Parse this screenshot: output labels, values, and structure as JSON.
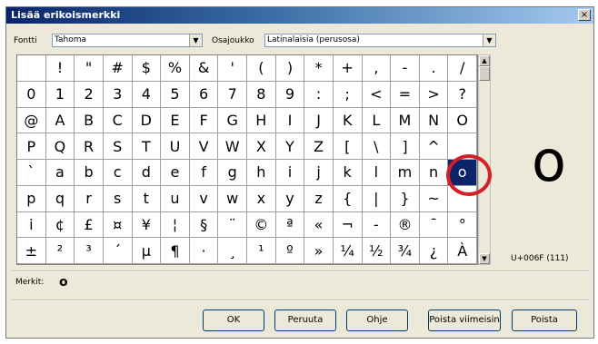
{
  "dialog": {
    "title": "Lisää erikoismerkki",
    "close": "×"
  },
  "font": {
    "label": "Fontti",
    "value": "Tahoma"
  },
  "subset": {
    "label": "Osajoukko",
    "value": "Latinalaisia (perusosa)"
  },
  "grid": {
    "rows": [
      [
        " ",
        "!",
        "\"",
        "#",
        "$",
        "%",
        "&",
        "'",
        "(",
        ")",
        "*",
        "+",
        ",",
        "-",
        ".",
        "/"
      ],
      [
        "0",
        "1",
        "2",
        "3",
        "4",
        "5",
        "6",
        "7",
        "8",
        "9",
        ":",
        ";",
        "<",
        "=",
        ">",
        "?"
      ],
      [
        "@",
        "A",
        "B",
        "C",
        "D",
        "E",
        "F",
        "G",
        "H",
        "I",
        "J",
        "K",
        "L",
        "M",
        "N",
        "O"
      ],
      [
        "P",
        "Q",
        "R",
        "S",
        "T",
        "U",
        "V",
        "W",
        "X",
        "Y",
        "Z",
        "[",
        "\\",
        "]",
        "^",
        ""
      ],
      [
        "`",
        "a",
        "b",
        "c",
        "d",
        "e",
        "f",
        "g",
        "h",
        "i",
        "j",
        "k",
        "l",
        "m",
        "n",
        "o"
      ],
      [
        "p",
        "q",
        "r",
        "s",
        "t",
        "u",
        "v",
        "w",
        "x",
        "y",
        "z",
        "{",
        "|",
        "}",
        "~",
        ""
      ],
      [
        "i",
        "¢",
        "£",
        "¤",
        "¥",
        "¦",
        "§",
        "¨",
        "©",
        "ª",
        "«",
        "¬",
        "-",
        "®",
        "¯",
        "°"
      ],
      [
        "±",
        "²",
        "³",
        "´",
        "µ",
        "¶",
        "·",
        "¸",
        "¹",
        "º",
        "»",
        "¼",
        "½",
        "¾",
        "¿",
        "À"
      ]
    ],
    "selected": {
      "row": 4,
      "col": 15
    }
  },
  "preview": {
    "char": "o",
    "code": "U+006F (111)"
  },
  "chars": {
    "label": "Merkit:",
    "value": "o"
  },
  "buttons": {
    "ok": "OK",
    "cancel": "Peruuta",
    "help": "Ohje",
    "remove_last": "Poista viimeisin",
    "remove": "Poista"
  },
  "colors": {
    "selection": "#0a246a",
    "annotation_circle": "#d62027"
  }
}
